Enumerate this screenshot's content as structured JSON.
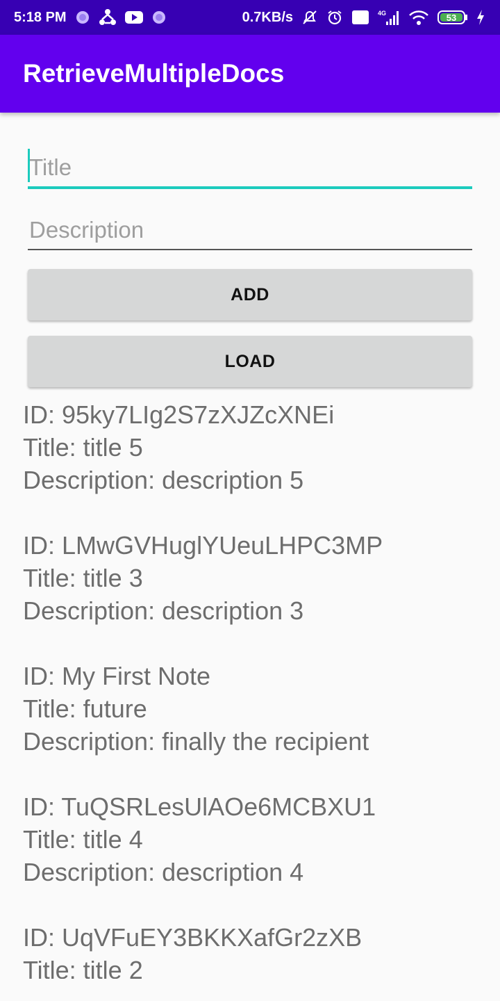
{
  "status_bar": {
    "time": "5:18 PM",
    "net_speed": "0.7KB/s",
    "network_label": "4G",
    "volte_label": "Vo LTE",
    "battery": "53",
    "left_icons": [
      "notification-dot-icon",
      "share-sync-icon",
      "youtube-icon",
      "notification-dot-icon"
    ],
    "right_icons": [
      "mute-alarm-icon",
      "alarm-clock-icon",
      "volte-icon",
      "signal-icon",
      "wifi-icon",
      "battery-icon",
      "charging-icon"
    ]
  },
  "app_bar": {
    "title": "RetrieveMultipleDocs"
  },
  "form": {
    "title_placeholder": "Title",
    "description_placeholder": "Description",
    "add_label": "ADD",
    "load_label": "LOAD"
  },
  "results": [
    {
      "id": "ID: 95ky7LIg2S7zXJZcXNEi",
      "title": "Title: title 5",
      "description": "Description: description 5"
    },
    {
      "id": "ID: LMwGVHuglYUeuLHPC3MP",
      "title": "Title: title 3",
      "description": "Description: description 3"
    },
    {
      "id": "ID: My First Note",
      "title": "Title: future",
      "description": "Description: finally the recipient"
    },
    {
      "id": "ID: TuQSRLesUlAOe6MCBXU1",
      "title": "Title: title 4",
      "description": "Description: description 4"
    },
    {
      "id": "ID: UqVFuEY3BKKXafGr2zXB",
      "title": "Title: title 2",
      "description": ""
    }
  ],
  "colors": {
    "status_bar": "#3700b3",
    "app_bar": "#6200ee",
    "accent": "#1ccbbd",
    "button": "#d6d7d7",
    "text": "#6d6d6d"
  }
}
